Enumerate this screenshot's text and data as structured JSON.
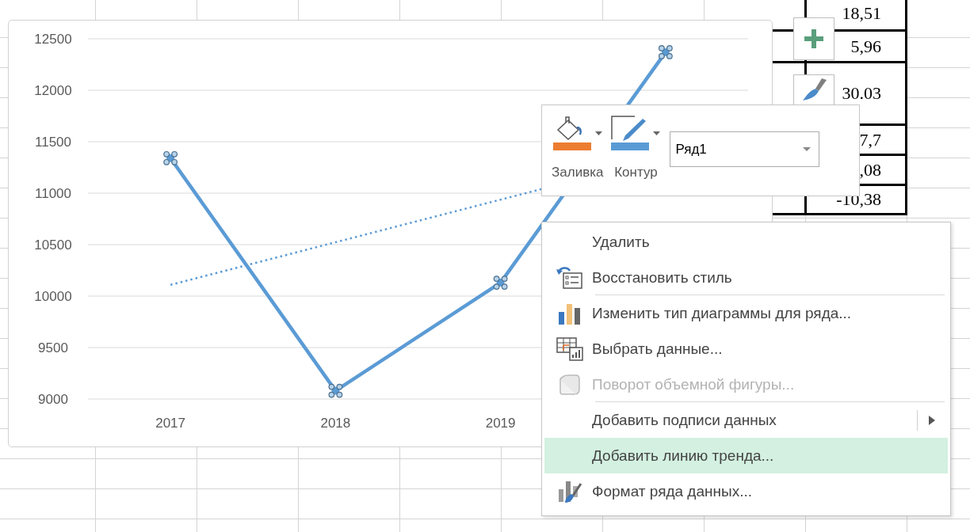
{
  "chart": {
    "chart_data": {
      "type": "line",
      "x": [
        2017,
        2018,
        2019,
        2020
      ],
      "xticks": [
        {
          "value": 2017,
          "label": "2017"
        },
        {
          "value": 2018,
          "label": "2018"
        },
        {
          "value": 2019,
          "label": "2019"
        }
      ],
      "series": [
        {
          "color": "#5b9bd5",
          "marker": true,
          "values": [
            11340,
            9080,
            10130,
            12370
          ]
        }
      ],
      "xlim": [
        2016.5,
        2020.5
      ],
      "ylim": [
        9000,
        12500
      ],
      "grid": true,
      "yticks": [
        {
          "value": 9000,
          "label": "9000"
        },
        {
          "value": 9500,
          "label": "9500"
        },
        {
          "value": 10000,
          "label": "10000"
        },
        {
          "value": 10500,
          "label": "10500"
        },
        {
          "value": 11000,
          "label": "11000"
        },
        {
          "value": 11500,
          "label": "11500"
        },
        {
          "value": 12000,
          "label": "12000"
        },
        {
          "value": 12500,
          "label": "12500"
        }
      ]
    }
  },
  "cells": [
    {
      "value": "18,51"
    },
    {
      "value": "5,96"
    },
    {
      "value": "30.03"
    },
    {
      "value": "7,7"
    },
    {
      "value": ",08"
    },
    {
      "value": "-10,38"
    }
  ],
  "mini_toolbar": {
    "tools": [
      {
        "label": "Заливка",
        "color": "#ed7d31"
      },
      {
        "label": "Контур",
        "color": "#5b9bd5"
      }
    ],
    "series_select": {
      "value": "Ряд1"
    }
  },
  "context_menu": {
    "items": [
      {
        "label": "Удалить",
        "disabled": false,
        "selected": false,
        "submenu": false,
        "separator_after": false
      },
      {
        "label": "Восстановить стиль",
        "disabled": false,
        "selected": false,
        "submenu": false,
        "separator_after": true
      },
      {
        "label": "Изменить тип диаграммы для ряда...",
        "disabled": false,
        "selected": false,
        "submenu": false,
        "separator_after": false
      },
      {
        "label": "Выбрать данные...",
        "disabled": false,
        "selected": false,
        "submenu": false,
        "separator_after": false
      },
      {
        "label": "Поворот объемной фигуры...",
        "disabled": true,
        "selected": false,
        "submenu": false,
        "separator_after": true
      },
      {
        "label": "Добавить подписи данных",
        "disabled": false,
        "selected": false,
        "submenu": true,
        "separator_after": false
      },
      {
        "label": "Добавить линию тренда...",
        "disabled": false,
        "selected": true,
        "submenu": false,
        "separator_after": false
      },
      {
        "label": "Формат ряда данных...",
        "disabled": false,
        "selected": false,
        "submenu": false,
        "separator_after": false
      }
    ]
  }
}
